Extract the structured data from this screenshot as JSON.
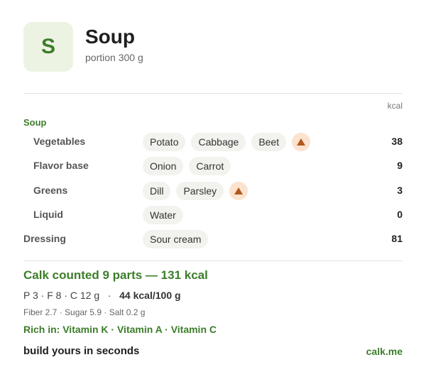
{
  "header": {
    "avatar_letter": "S",
    "title": "Soup",
    "subtitle": "portion 300 g"
  },
  "table": {
    "unit_label": "kcal",
    "section_label": "Soup",
    "rows": [
      {
        "label": "Vegetables",
        "chips": [
          "Potato",
          "Cabbage",
          "Beet"
        ],
        "warning": true,
        "kcal": "38"
      },
      {
        "label": "Flavor base",
        "chips": [
          "Onion",
          "Carrot"
        ],
        "warning": false,
        "kcal": "9"
      },
      {
        "label": "Greens",
        "chips": [
          "Dill",
          "Parsley"
        ],
        "warning": true,
        "kcal": "3"
      },
      {
        "label": "Liquid",
        "chips": [
          "Water"
        ],
        "warning": false,
        "kcal": "0"
      },
      {
        "label": "Dressing",
        "chips": [
          "Sour cream"
        ],
        "warning": false,
        "kcal": "81"
      }
    ]
  },
  "summary": {
    "headline": "Calk counted 9 parts — 131 kcal",
    "macros": "P 3 · F 8 · C 12 g",
    "separator": "·",
    "energy": "44 kcal/100 g",
    "micros": "Fiber 2.7 · Sugar 5.9 · Salt 0.2 g",
    "rich_in": "Rich in: Vitamin K · Vitamin A · Vitamin C"
  },
  "footer": {
    "tagline": "build yours in seconds",
    "link": "calk.me"
  },
  "colors": {
    "accent": "#3c7d2a",
    "avatar_bg": "#edf3e3",
    "chip_bg": "#f2f2ee",
    "warning_bg": "#fbe3cf",
    "warning_icon": "#b25a1e"
  },
  "icons": {
    "warning": "warning-triangle-icon"
  }
}
